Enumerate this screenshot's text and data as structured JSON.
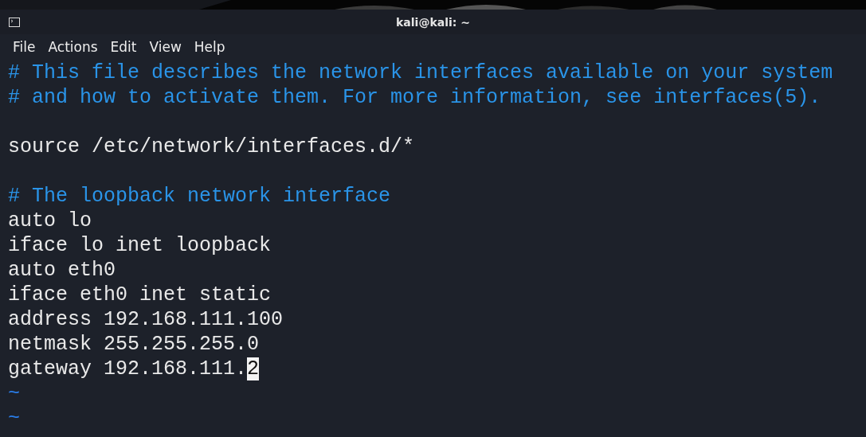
{
  "window": {
    "title": "kali@kali: ~"
  },
  "menu": [
    {
      "label": "File"
    },
    {
      "label": "Actions"
    },
    {
      "label": "Edit"
    },
    {
      "label": "View"
    },
    {
      "label": "Help"
    }
  ],
  "lines": [
    {
      "kind": "comment",
      "text": "# This file describes the network interfaces available on your system"
    },
    {
      "kind": "comment",
      "text": "# and how to activate them. For more information, see interfaces(5)."
    },
    {
      "kind": "blank"
    },
    {
      "kind": "code",
      "text": "source /etc/network/interfaces.d/*"
    },
    {
      "kind": "blank"
    },
    {
      "kind": "comment",
      "text": "# The loopback network interface"
    },
    {
      "kind": "code",
      "text": "auto lo"
    },
    {
      "kind": "code",
      "text": "iface lo inet loopback"
    },
    {
      "kind": "code",
      "text": "auto eth0"
    },
    {
      "kind": "code",
      "text": "iface eth0 inet static"
    },
    {
      "kind": "code",
      "text": "address 192.168.111.100"
    },
    {
      "kind": "code",
      "text": "netmask 255.255.255.0"
    },
    {
      "kind": "code",
      "text": "gateway 192.168.111.",
      "cursor": "2"
    },
    {
      "kind": "tilde",
      "text": "~"
    },
    {
      "kind": "tilde",
      "text": "~"
    }
  ]
}
